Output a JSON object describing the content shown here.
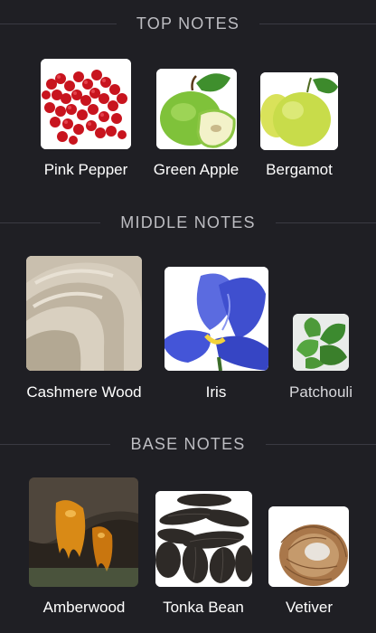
{
  "sections": [
    {
      "title": "TOP NOTES",
      "notes": [
        {
          "label": "Pink Pepper",
          "icon": "pink-pepper-image"
        },
        {
          "label": "Green Apple",
          "icon": "green-apple-image"
        },
        {
          "label": "Bergamot",
          "icon": "bergamot-image"
        }
      ]
    },
    {
      "title": "MIDDLE NOTES",
      "notes": [
        {
          "label": "Cashmere Wood",
          "icon": "cashmere-wood-image"
        },
        {
          "label": "Iris",
          "icon": "iris-image"
        },
        {
          "label": "Patchouli",
          "icon": "patchouli-image"
        }
      ]
    },
    {
      "title": "BASE NOTES",
      "notes": [
        {
          "label": "Amberwood",
          "icon": "amberwood-image"
        },
        {
          "label": "Tonka Bean",
          "icon": "tonka-bean-image"
        },
        {
          "label": "Vetiver",
          "icon": "vetiver-image"
        }
      ]
    }
  ],
  "colors": {
    "background": "#1f1f24",
    "section_title": "#bdbdc2",
    "divider": "#3a3a42",
    "label": "#ffffff"
  }
}
